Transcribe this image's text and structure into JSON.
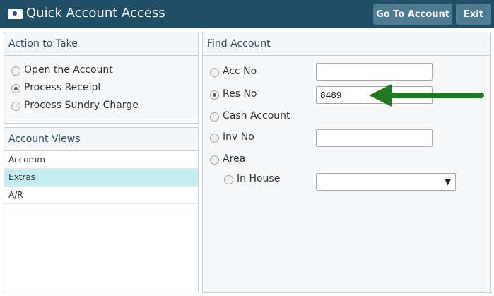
{
  "window": {
    "title": "Quick Account Access",
    "icon": "account-card-icon"
  },
  "toolbar": {
    "goto_label": "Go To Account",
    "exit_label": "Exit"
  },
  "action_panel": {
    "title": "Action to Take",
    "options": [
      {
        "label": "Open the Account",
        "checked": false
      },
      {
        "label": "Process Receipt",
        "checked": true
      },
      {
        "label": "Process Sundry Charge",
        "checked": false
      }
    ]
  },
  "views_panel": {
    "title": "Account Views",
    "items": [
      {
        "label": "Accomm",
        "selected": false
      },
      {
        "label": "Extras",
        "selected": true
      },
      {
        "label": "A/R",
        "selected": false
      }
    ]
  },
  "find_panel": {
    "title": "Find Account",
    "acc_no": {
      "label": "Acc No",
      "value": ""
    },
    "res_no": {
      "label": "Res No",
      "value": "8489",
      "checked": true
    },
    "cash_account": {
      "label": "Cash Account"
    },
    "inv_no": {
      "label": "Inv No",
      "value": ""
    },
    "area": {
      "label": "Area"
    },
    "in_house": {
      "label": "In House",
      "value": ""
    }
  },
  "colors": {
    "titlebar": "#1f4e66",
    "button": "#4f7b90",
    "selected_row": "#c4ecf3",
    "arrow": "#1e7a1e"
  }
}
